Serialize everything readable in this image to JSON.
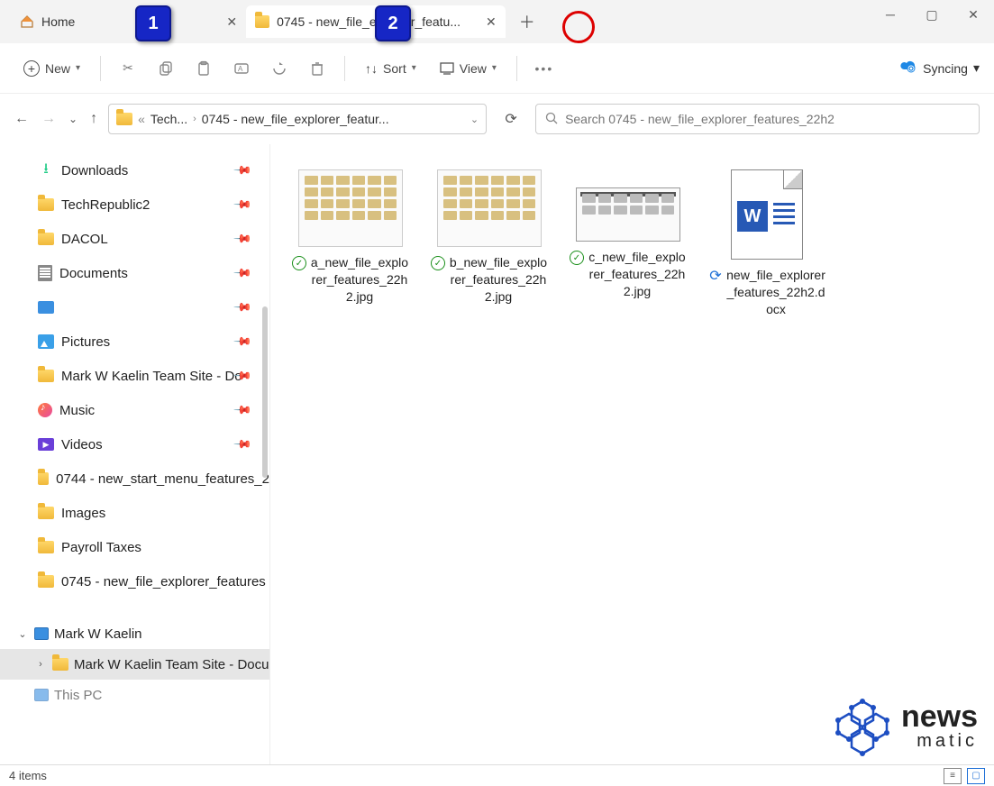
{
  "annotations": {
    "callout1": "1",
    "callout2": "2"
  },
  "tabs": {
    "home": "Home",
    "active": "0745 - new_file_explorer_featu..."
  },
  "toolbar": {
    "new": "New",
    "sort": "Sort",
    "view": "View",
    "syncing": "Syncing"
  },
  "address": {
    "crumb1": "Tech...",
    "crumb2": "0745 - new_file_explorer_featur..."
  },
  "search": {
    "placeholder": "Search 0745 - new_file_explorer_features_22h2"
  },
  "sidebar": {
    "items": [
      {
        "label": "Downloads",
        "icon": "download",
        "pinned": true
      },
      {
        "label": "TechRepublic2",
        "icon": "folder",
        "pinned": true
      },
      {
        "label": "DACOL",
        "icon": "folder",
        "pinned": true
      },
      {
        "label": "Documents",
        "icon": "doc",
        "pinned": true
      },
      {
        "label": "",
        "icon": "sq",
        "pinned": true
      },
      {
        "label": "Pictures",
        "icon": "pic",
        "pinned": true
      },
      {
        "label": "Mark W Kaelin Team Site - Do",
        "icon": "folder",
        "pinned": true
      },
      {
        "label": "Music",
        "icon": "music",
        "pinned": true
      },
      {
        "label": "Videos",
        "icon": "vid",
        "pinned": true
      },
      {
        "label": "0744 - new_start_menu_features_2",
        "icon": "folder",
        "pinned": false
      },
      {
        "label": "Images",
        "icon": "folder",
        "pinned": false
      },
      {
        "label": "Payroll Taxes",
        "icon": "folder",
        "pinned": false
      },
      {
        "label": "0745 - new_file_explorer_features",
        "icon": "folder",
        "pinned": false
      }
    ],
    "tree": {
      "root": "Mark W Kaelin",
      "child": "Mark W Kaelin Team Site - Docu",
      "pc": "This PC"
    }
  },
  "files": [
    {
      "name": "a_new_file_explorer_features_22h2.jpg",
      "status": "synced",
      "thumb": "shot1"
    },
    {
      "name": "b_new_file_explorer_features_22h2.jpg",
      "status": "synced",
      "thumb": "shot2"
    },
    {
      "name": "c_new_file_explorer_features_22h2.jpg",
      "status": "synced",
      "thumb": "shot3"
    },
    {
      "name": "new_file_explorer_features_22h2.docx",
      "status": "syncing",
      "thumb": "docx"
    }
  ],
  "status": {
    "count": "4 items"
  },
  "watermark": {
    "line1": "news",
    "line2": "matic"
  }
}
